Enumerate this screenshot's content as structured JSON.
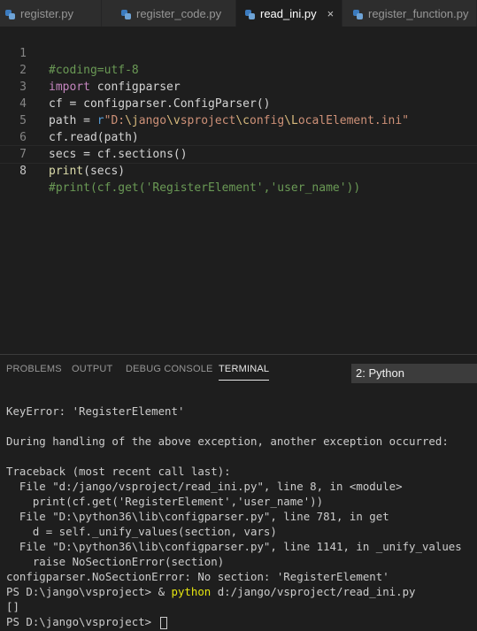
{
  "tabs": [
    {
      "label": "register.py",
      "active": false
    },
    {
      "label": "register_code.py",
      "active": false
    },
    {
      "label": "read_ini.py",
      "active": true
    },
    {
      "label": "register_function.py",
      "active": false
    }
  ],
  "close_glyph": "×",
  "editor": {
    "current_line": 8,
    "line_numbers": [
      "1",
      "2",
      "3",
      "4",
      "5",
      "6",
      "7",
      "8"
    ],
    "lines": [
      {
        "comment": "#coding=utf-8"
      },
      {
        "kw": "import",
        "rest": " configparser"
      },
      {
        "a": "cf",
        "b": " = configparser.",
        "fn": "ConfigParser",
        "c": "()"
      },
      {
        "a": "path",
        "b": " = ",
        "prefix": "r",
        "s1": "\"D:",
        "e1": "\\j",
        "s2": "ango",
        "e2": "\\v",
        "s3": "sproject",
        "e3": "\\c",
        "s4": "onfig",
        "e4": "\\L",
        "s5": "ocalElement.ini\""
      },
      {
        "a": "cf",
        "b": ".",
        "fn": "read",
        "c": "(path)"
      },
      {
        "a": "secs",
        "b": " = cf.",
        "fn": "sections",
        "c": "()"
      },
      {
        "fn": "print",
        "c": "(secs)"
      },
      {
        "comment": "#print(cf.get('RegisterElement','user_name'))"
      }
    ]
  },
  "panel": {
    "tabs": [
      "PROBLEMS",
      "OUTPUT",
      "DEBUG CONSOLE",
      "TERMINAL"
    ],
    "active_tab": "TERMINAL",
    "terminal_selector": "2: Python"
  },
  "terminal": {
    "lines": [
      "KeyError: 'RegisterElement'",
      "",
      "During handling of the above exception, another exception occurred:",
      "",
      "Traceback (most recent call last):",
      "  File \"d:/jango/vsproject/read_ini.py\", line 8, in <module>",
      "    print(cf.get('RegisterElement','user_name'))",
      "  File \"D:\\python36\\lib\\configparser.py\", line 781, in get",
      "    d = self._unify_values(section, vars)",
      "  File \"D:\\python36\\lib\\configparser.py\", line 1141, in _unify_values",
      "    raise NoSectionError(section)",
      "configparser.NoSectionError: No section: 'RegisterElement'"
    ],
    "cmd_prompt": "PS D:\\jango\\vsproject> & ",
    "cmd_exe": "python",
    "cmd_arg": " d:/jango/vsproject/read_ini.py",
    "output": "[]",
    "final_prompt": "PS D:\\jango\\vsproject> "
  }
}
